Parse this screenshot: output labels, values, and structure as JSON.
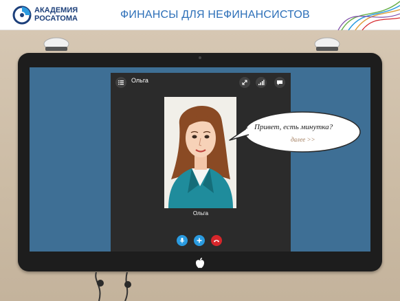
{
  "header": {
    "logo_line1": "АКАДЕМИЯ",
    "logo_line2": "РОСАТОМА",
    "title": "ФИНАНСЫ ДЛЯ НЕФИНАНСИСТОВ"
  },
  "call": {
    "caller_name_top": "Ольга",
    "caller_name_bottom": "Ольга",
    "top_buttons": [
      "fullscreen-icon",
      "signal-icon",
      "chat-icon"
    ],
    "controls": [
      "microphone-icon",
      "add-icon",
      "hangup-icon"
    ]
  },
  "bubble": {
    "text": "Привет, есть минутка?",
    "next_link": "далее >>"
  },
  "colors": {
    "header_title": "#2c6fb8",
    "screen": "#3e6f95",
    "call_bg": "#2b2b2b",
    "accent_blue": "#2a9be0",
    "hangup_red": "#d6262b"
  }
}
